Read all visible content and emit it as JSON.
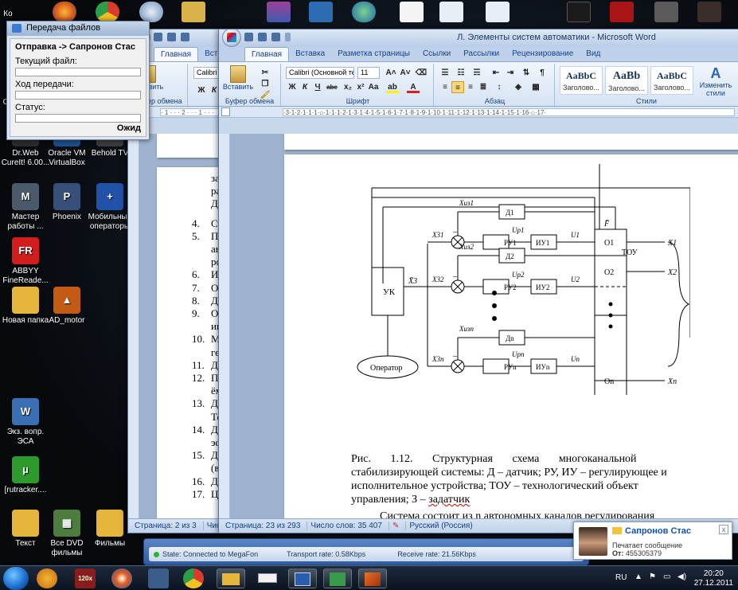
{
  "desktop": {
    "icons": [
      {
        "label": "Dr.Web CureIt! 6.00...",
        "icon": "drweb-icon",
        "color": "#2b2b2b",
        "short": "Dr"
      },
      {
        "label": "Oracle VM VirtualBox",
        "icon": "virtualbox-icon",
        "color": "#1b4f8a",
        "short": "VB"
      },
      {
        "label": "Behold TV",
        "icon": "tv-icon",
        "color": "#3b3b3b",
        "short": "TV"
      },
      {
        "label": "Мастер работы ...",
        "icon": "camera-icon",
        "color": "#4a5a6a",
        "short": "M"
      },
      {
        "label": "Phoenix",
        "icon": "phoenix-icon",
        "color": "#36507a",
        "short": "P"
      },
      {
        "label": "Мобильные операторы",
        "icon": "mobile-icon",
        "color": "#2251a8",
        "short": "+"
      },
      {
        "label": "ABBYY FineReade...",
        "icon": "abbyy-icon",
        "color": "#d21d1d",
        "short": "FR"
      },
      {
        "label": "Новая папка",
        "icon": "folder-icon",
        "color": "#e5b53c",
        "short": ""
      },
      {
        "label": "AD_motor",
        "icon": "matlab-icon",
        "color": "#c35b16",
        "short": "▲"
      },
      {
        "label": "Экз. вопр. ЭСА",
        "icon": "document-icon",
        "color": "#3b6fb5",
        "short": "W"
      },
      {
        "label": "[rutracker....",
        "icon": "utorrent-icon",
        "color": "#2c9a2c",
        "short": "µ"
      },
      {
        "label": "Текст",
        "icon": "folder-icon",
        "color": "#e5b53c",
        "short": ""
      },
      {
        "label": "Все DVD фильмы",
        "icon": "dvd-icon",
        "color": "#4c7d3c",
        "short": "▦"
      },
      {
        "label": "Фильмы",
        "icon": "folder-icon",
        "color": "#e5b53c",
        "short": ""
      }
    ],
    "partial_label": "Ко",
    "partial_label2": "Co"
  },
  "transfer": {
    "title": "Передача файлов",
    "header": "Отправка -> Сапронов Стас",
    "current_file_label": "Текущий файл:",
    "progress_label": "Ход передачи:",
    "status_label": "Статус:",
    "status_value": "Ожид"
  },
  "word_back": {
    "tabs": [
      "Главная",
      "Вст"
    ],
    "paste_label": "Вставить",
    "font_value": "Calibri",
    "clipboard_label": "Буфер обмена",
    "status": "Страница: 2 из 3",
    "status2": "Числ",
    "list_top": [
      "задан",
      "работ",
      "Делят"
    ],
    "list": [
      {
        "n": "4.",
        "lines": [
          "Струк"
        ]
      },
      {
        "n": "5.",
        "lines": [
          "Поня",
          "автом",
          "роду"
        ]
      },
      {
        "n": "6.",
        "lines": [
          "Иерар"
        ]
      },
      {
        "n": "7.",
        "lines": [
          "Опред"
        ]
      },
      {
        "n": "8.",
        "lines": [
          "Датчи"
        ]
      },
      {
        "n": "9.",
        "lines": [
          "Обоб",
          "индук"
        ]
      },
      {
        "n": "10.",
        "lines": [
          "Магн",
          "генер"
        ]
      },
      {
        "n": "11.",
        "lines": [
          "Датчи"
        ]
      },
      {
        "n": "12.",
        "lines": [
          "Прин",
          "ёмкос"
        ]
      },
      {
        "n": "13.",
        "lines": [
          "Датчи",
          "Тензо"
        ]
      },
      {
        "n": "14.",
        "lines": [
          "Датчи",
          "эффе"
        ]
      },
      {
        "n": "15.",
        "lines": [
          "Датчи",
          "(вело"
        ]
      },
      {
        "n": "16.",
        "lines": [
          "Датчи"
        ]
      },
      {
        "n": "17.",
        "lines": [
          "Цифр"
        ]
      }
    ]
  },
  "word_front": {
    "title": "Л. Элементы систем автоматики - Microsoft Word",
    "tabs": [
      "Главная",
      "Вставка",
      "Разметка страницы",
      "Ссылки",
      "Рассылки",
      "Рецензирование",
      "Вид"
    ],
    "paste_label": "Вставить",
    "font_name": "Calibri (Основной те",
    "font_size": "11",
    "groups": {
      "clipboard": "Буфер обмена",
      "font": "Шрифт",
      "paragraph": "Абзац",
      "styles": "Стили"
    },
    "styles": [
      {
        "sample": "AaBbC",
        "name": "Заголово..."
      },
      {
        "sample": "AaBb",
        "name": "Заголово..."
      },
      {
        "sample": "AaBbC",
        "name": "Заголово..."
      }
    ],
    "change_styles": "Изменить стили",
    "status_page": "Страница: 23 из 293",
    "status_words": "Число слов: 35 407",
    "status_lang": "Русский (Россия)",
    "caption_lines": [
      "Рис.       1.12.       Структурная       схема       многоканальной",
      "стабилизирующей системы: Д – датчик; РУ, ИУ – регулирующее и",
      "исполнительное устройства; ТОУ – технологический объект",
      "управления; З – "
    ],
    "caption_last": "задатчик",
    "para_line": "Система состоит из n автономных каналов регулирования"
  },
  "diagram": {
    "uk": "УК",
    "operator": "Оператор",
    "tou": "ТОУ",
    "f": "F̄",
    "x3": "X̄3",
    "channels": [
      {
        "xiz": "Xиз1",
        "x3": "X31",
        "d": "Д1",
        "ru": "РУ1",
        "iu": "ИУ1",
        "up": "Uр1",
        "u": "U1",
        "o": "O1",
        "x": "X1"
      },
      {
        "xiz": "Xиз2",
        "x3": "X32",
        "d": "Д2",
        "ru": "РУ2",
        "iu": "ИУ2",
        "up": "Uр2",
        "u": "U2",
        "o": "O2",
        "x": "X2"
      },
      {
        "xiz": "Xизn",
        "x3": "X3n",
        "d": "Дn",
        "ru": "РУn",
        "iu": "ИУn",
        "up": "Uрn",
        "u": "Un",
        "o": "On",
        "x": "Xn"
      }
    ],
    "minus": "–"
  },
  "mega": {
    "state": "State: Connected to MegaFon",
    "tx": "Transport rate: 0.58Kbps",
    "rx": "Receive rate: 21.56Kbps"
  },
  "notification": {
    "name": "Сапронов Стас",
    "line1": "Печатает сообщение",
    "from_label": "От:",
    "from_value": "455305379",
    "close": "x"
  },
  "taskbar": {
    "lang": "RU",
    "time": "20:20",
    "date": "27.12.2011",
    "badge": "120x"
  }
}
